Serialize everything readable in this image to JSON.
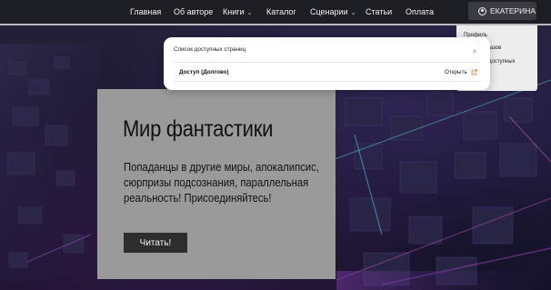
{
  "nav": {
    "items": [
      {
        "label": "Главная",
        "has_dropdown": false
      },
      {
        "label": "Об авторе",
        "has_dropdown": false
      },
      {
        "label": "Книги",
        "has_dropdown": true
      },
      {
        "label": "Каталог",
        "has_dropdown": false
      },
      {
        "label": "Сценарии",
        "has_dropdown": true
      },
      {
        "label": "Статьи",
        "has_dropdown": false
      },
      {
        "label": "Оплата",
        "has_dropdown": false
      }
    ],
    "user": {
      "name": "ЕКАТЕРИНА",
      "icon": "user-circle-icon"
    }
  },
  "user_menu": {
    "items": [
      "Профиль",
      "заказов",
      "доступных"
    ]
  },
  "hero": {
    "title": "Мир фантастики",
    "text": "Попаданцы в другие миры, апокалипсис, сюрпризы подсознания, параллельная реальность! Присоединяйтесь!",
    "button": "Читать!"
  },
  "modal": {
    "title": "Список доступных страниц",
    "close_icon": "close-icon",
    "rows": [
      {
        "label": "Доступ (Долгово)",
        "action": "Открыть",
        "action_icon": "external-link-icon",
        "accent": "#e8733a"
      }
    ]
  },
  "colors": {
    "nav_bg": "#1d1d24",
    "hero_bg": "#9a9a9a",
    "hero_button_bg": "#2d2d2d",
    "external_link": "#e8733a"
  }
}
